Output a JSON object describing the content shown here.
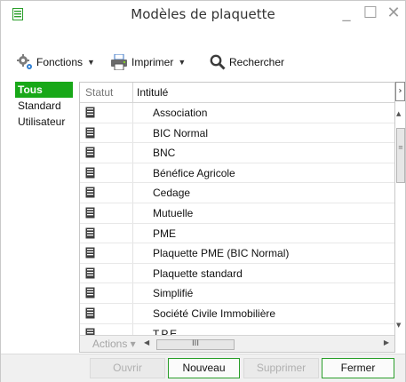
{
  "window": {
    "title": "Modèles de plaquette",
    "minimize": "_",
    "maximize": "☐",
    "close": "✕"
  },
  "toolbar": {
    "fonctions_label": "Fonctions",
    "imprimer_label": "Imprimer",
    "rechercher_label": "Rechercher",
    "caret": "▼"
  },
  "filters": {
    "tous": "Tous",
    "standard": "Standard",
    "utilisateur": "Utilisateur"
  },
  "grid": {
    "columns": {
      "statut": "Statut",
      "intitule": "Intitulé"
    },
    "rows": [
      "Association",
      "BIC Normal",
      "BNC",
      "Bénéfice Agricole",
      "Cedage",
      "Mutuelle",
      "PME",
      "Plaquette PME (BIC Normal)",
      "Plaquette standard",
      "Simplifié",
      "Société Civile Immobilière",
      "T.P.E."
    ],
    "actions_label": "Actions ▾",
    "hscroll_grip": "III",
    "expand_glyph": "›"
  },
  "buttons": {
    "ouvrir": "Ouvrir",
    "nouveau": "Nouveau",
    "supprimer": "Supprimer",
    "fermer": "Fermer"
  },
  "colors": {
    "accent_green": "#18a818",
    "button_border_green": "#2a9e2a"
  }
}
